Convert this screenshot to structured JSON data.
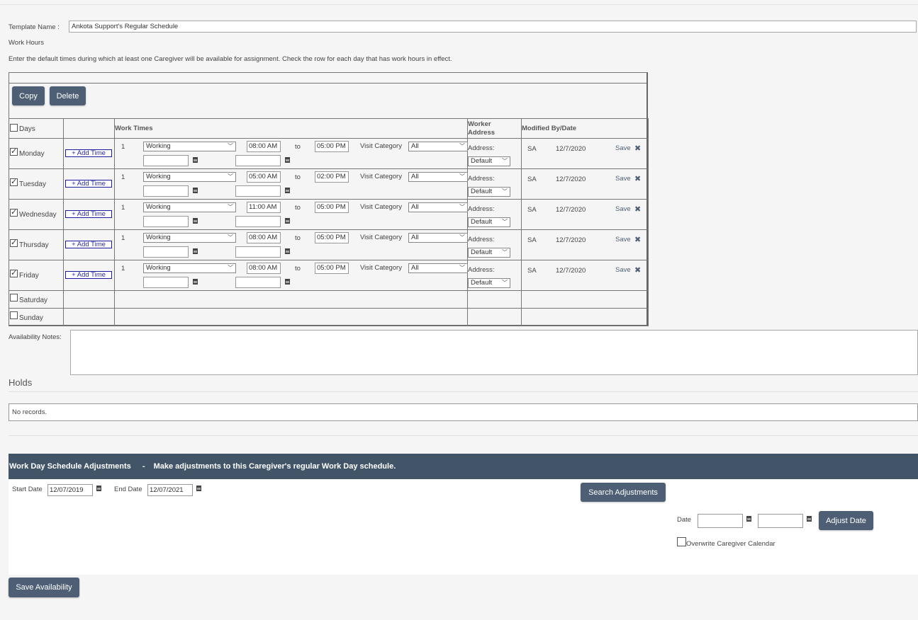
{
  "template": {
    "name_label": "Template Name :",
    "name_value": "Ankota Support's Regular Schedule"
  },
  "work_hours": {
    "heading": "Work Hours",
    "instructions": "Enter the default times during which at least one Caregiver will be available for assignment. Check the row for each day that has work hours in effect."
  },
  "toolbar": {
    "copy_label": "Copy",
    "delete_label": "Delete"
  },
  "table": {
    "headers": {
      "days": "Days",
      "work_times": "Work Times",
      "worker_address": "Worker Address",
      "modified": "Modified By/Date"
    },
    "add_time_label": "+ Add Time",
    "to_label": "to",
    "visit_category_label": "Visit Category",
    "address_label": "Address:",
    "save_label": "Save",
    "rows": [
      {
        "day": "Monday",
        "checked": true,
        "index": "1",
        "status": "Working",
        "start": "08:00 AM",
        "end": "05:00 PM",
        "visit_category": "All",
        "address": "Default",
        "by": "SA",
        "date": "12/7/2020"
      },
      {
        "day": "Tuesday",
        "checked": true,
        "index": "1",
        "status": "Working",
        "start": "05:00 AM",
        "end": "02:00 PM",
        "visit_category": "All",
        "address": "Default",
        "by": "SA",
        "date": "12/7/2020"
      },
      {
        "day": "Wednesday",
        "checked": true,
        "index": "1",
        "status": "Working",
        "start": "11:00 AM",
        "end": "05:00 PM",
        "visit_category": "All",
        "address": "Default",
        "by": "SA",
        "date": "12/7/2020"
      },
      {
        "day": "Thursday",
        "checked": true,
        "index": "1",
        "status": "Working",
        "start": "08:00 AM",
        "end": "05:00 PM",
        "visit_category": "All",
        "address": "Default",
        "by": "SA",
        "date": "12/7/2020"
      },
      {
        "day": "Friday",
        "checked": true,
        "index": "1",
        "status": "Working",
        "start": "08:00 AM",
        "end": "05:00 PM",
        "visit_category": "All",
        "address": "Default",
        "by": "SA",
        "date": "12/7/2020"
      },
      {
        "day": "Saturday",
        "checked": false
      },
      {
        "day": "Sunday",
        "checked": false
      }
    ]
  },
  "notes": {
    "label": "Availability Notes:"
  },
  "holds": {
    "title": "Holds",
    "empty_text": "No records."
  },
  "adjustments": {
    "title": "Work Day Schedule Adjustments",
    "separator": "-",
    "subtitle": "Make adjustments to this Caregiver's regular Work Day schedule.",
    "start_label": "Start Date",
    "start_value": "12/07/2019",
    "end_label": "End Date",
    "end_value": "12/07/2021",
    "search_label": "Search Adjustments",
    "date_label": "Date",
    "adjust_label": "Adjust Date",
    "overwrite_label": "Overwrite Caregiver Calendar"
  },
  "footer": {
    "save_label": "Save Availability"
  },
  "colors": {
    "button": "#4e5f75",
    "header_bar": "#425568",
    "background": "#f5f5f5"
  }
}
